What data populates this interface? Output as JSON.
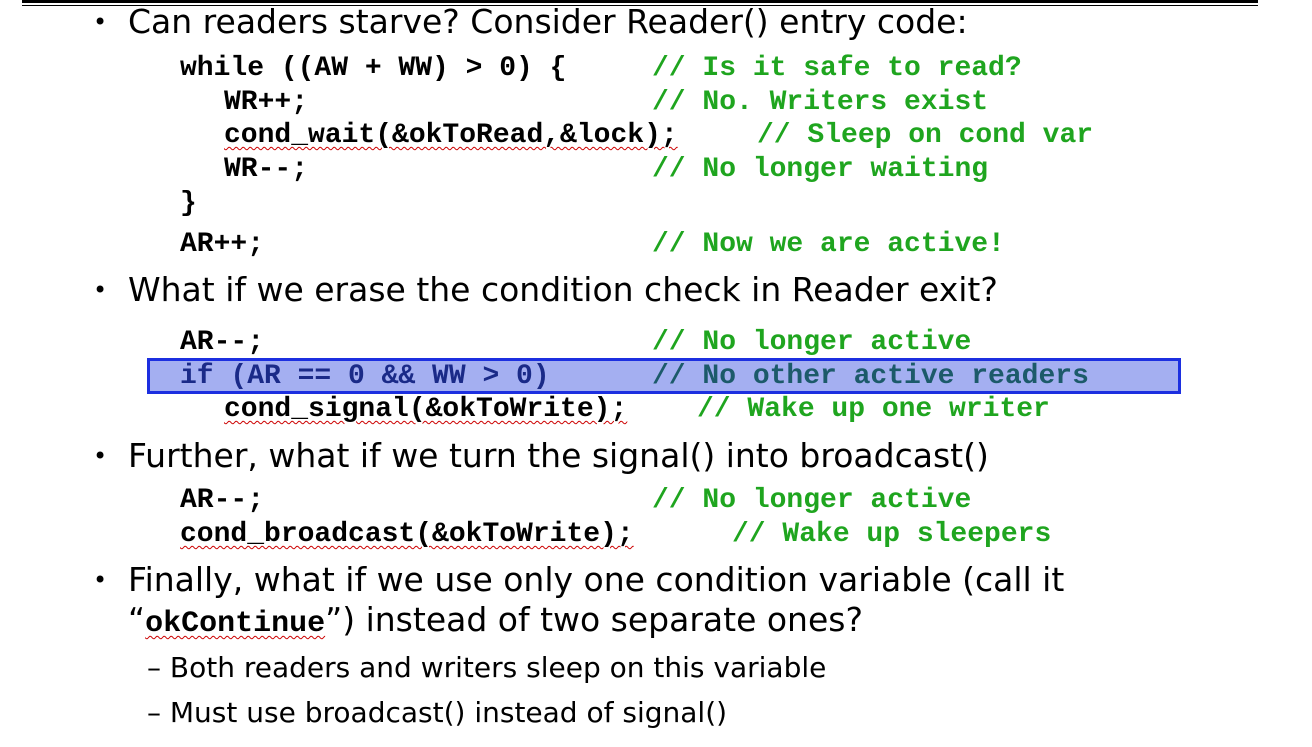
{
  "bullets": {
    "b1": "Can readers starve?  Consider Reader() entry code:",
    "b2": "What if we erase the condition check in Reader exit?",
    "b3": "Further, what if we turn the signal() into broadcast()",
    "b4_line1": "Finally, what if we use only one condition variable (call it",
    "b4_open": "“",
    "b4_code": "okContinue",
    "b4_rest": "”) instead of two separate ones?"
  },
  "bullet_glyph": "•",
  "subbullets": [
    "– Both readers and writers sleep on this variable",
    "– Must use broadcast() instead of signal()"
  ],
  "code1": {
    "l1": "while ((AW + WW) > 0) {",
    "c1": "// Is it safe to read?",
    "l2": "WR++;",
    "c2": "// No. Writers exist",
    "l3": "cond_wait(&okToRead,&lock);",
    "c3": "// Sleep on cond var",
    "l4": "WR--;",
    "c4": "// No longer waiting",
    "l5": "}",
    "l6": "AR++;",
    "c6": "// Now we are active!"
  },
  "code2": {
    "l1": "AR--;",
    "c1": "// No longer active",
    "l2": "if (AR == 0 && WW > 0)",
    "c2": "// No other active readers",
    "l3": "cond_signal(&okToWrite);",
    "c3": "// Wake up one writer"
  },
  "code3": {
    "l1": "AR--;",
    "c1": "// No longer active",
    "l2": "cond_broadcast(&okToWrite);",
    "c2": "// Wake up sleepers"
  },
  "colors": {
    "comment": "#1fa51f",
    "highlight_border": "#1c2fe0"
  }
}
